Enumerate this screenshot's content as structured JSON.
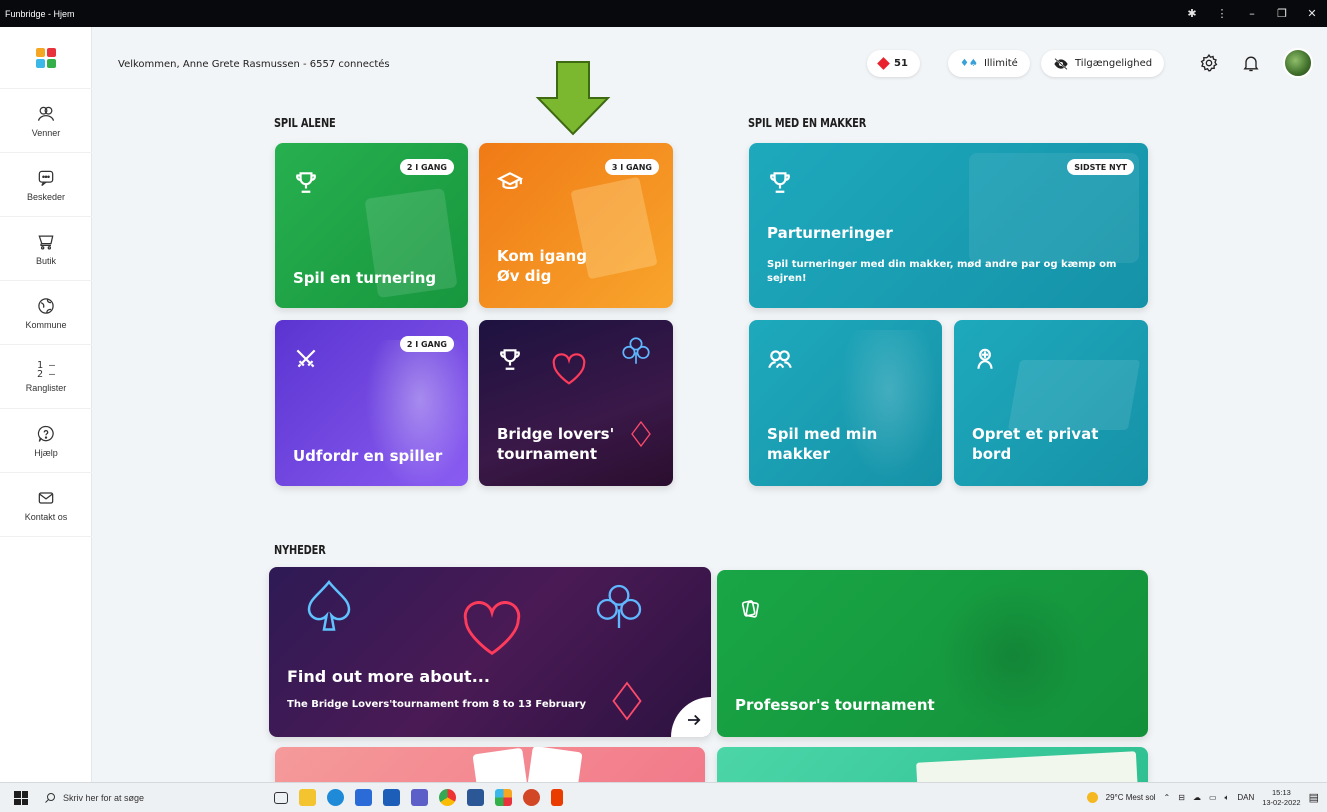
{
  "window": {
    "title": "Funbridge - Hjem",
    "controls": [
      "extensions-icon",
      "more-icon",
      "minimize-icon",
      "restore-icon",
      "close-icon"
    ]
  },
  "sidebar": {
    "items": [
      {
        "label": "Venner",
        "icon": "friends-icon"
      },
      {
        "label": "Beskeder",
        "icon": "chat-icon"
      },
      {
        "label": "Butik",
        "icon": "cart-icon"
      },
      {
        "label": "Kommune",
        "icon": "globe-icon"
      },
      {
        "label": "Ranglister",
        "icon": "ranking-icon",
        "rank_top": "1 —",
        "rank_bottom": "2 —"
      },
      {
        "label": "Hjælp",
        "icon": "help-icon"
      },
      {
        "label": "Kontakt os",
        "icon": "mail-icon"
      }
    ]
  },
  "header": {
    "welcome": "Velkommen, Anne Grete Rasmussen  -  6557 connectés",
    "diamonds": "51",
    "unlimited": "Illimité",
    "accessibility": "Tilgængelighed"
  },
  "solo": {
    "title": "SPIL ALENE",
    "cards": [
      {
        "title": "Spil en turnering",
        "badge": "2 I GANG",
        "icon": "trophy-icon",
        "color": "#1fa84a"
      },
      {
        "title": "Kom igang",
        "title2": "Øv dig",
        "badge": "3 I GANG",
        "icon": "graduation-cap-icon",
        "color": "#f58a1f"
      },
      {
        "title": "Udfordr en spiller",
        "badge": "2 I GANG",
        "icon": "crossed-swords-icon",
        "color": "#6a3fd8"
      },
      {
        "title": "Bridge lovers'",
        "title2": "tournament",
        "icon": "trophy-icon",
        "color": "#2a1240"
      }
    ]
  },
  "partner": {
    "title": "SPIL MED EN MAKKER",
    "cards": [
      {
        "title": "Parturneringer",
        "subtitle": "Spil turneringer med din makker, mød andre par og kæmp om sejren!",
        "badge": "SIDSTE NYT",
        "icon": "trophy-icon",
        "color": "#1ba3b7"
      },
      {
        "title": "Spil med min",
        "title2": "makker",
        "icon": "partners-icon",
        "color": "#1ba3b7"
      },
      {
        "title": "Opret et privat",
        "title2": "bord",
        "icon": "private-table-icon",
        "color": "#1ba3b7"
      }
    ]
  },
  "news": {
    "title": "NYHEDER",
    "cards": [
      {
        "title": "Find out more about...",
        "subtitle": "The Bridge Lovers'tournament from 8 to 13 February",
        "icon": "arrow-right-icon"
      },
      {
        "title": "Professor's tournament",
        "icon": "cards-icon"
      }
    ]
  },
  "taskbar": {
    "search_placeholder": "Skriv her for at søge",
    "weather": "29°C  Mest sol",
    "language": "DAN",
    "time": "15:13",
    "date": "13-02-2022"
  }
}
